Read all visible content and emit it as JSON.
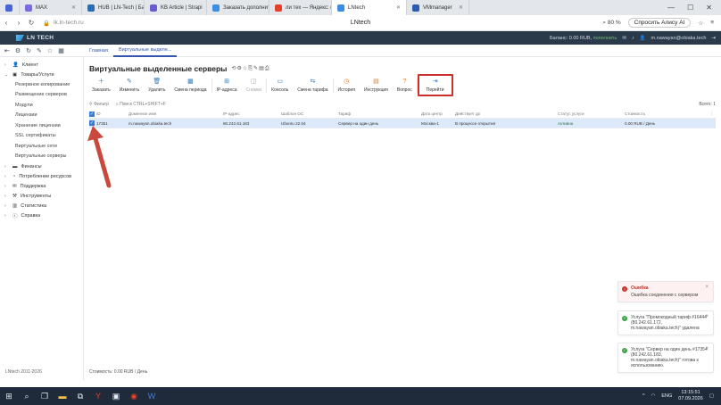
{
  "browser": {
    "tabs": [
      {
        "label": "",
        "color": "#4a63d8",
        "active": false
      },
      {
        "label": "MAX",
        "color": "#7b6be0",
        "active": false
      },
      {
        "label": "HUB | LN-Tech | База знаний",
        "color": "#2b6cb0",
        "active": false
      },
      {
        "label": "KB Article | Strapi",
        "color": "#6a5acd",
        "active": false
      },
      {
        "label": "Заказать дополнительный",
        "color": "#3a8ee6",
        "active": false
      },
      {
        "label": "ли тех — Яндекс: нашлось",
        "color": "#e6402b",
        "active": false
      },
      {
        "label": "LNtech",
        "color": "#3a8ee6",
        "active": true
      },
      {
        "label": "VMmanager",
        "color": "#2a5db0",
        "active": false
      }
    ],
    "page_title": "LNtech",
    "url": "lk.ln-tech.ru",
    "zoom": "80 %",
    "ai_button": "Спросить Алису AI"
  },
  "app_header": {
    "logo_text": "LN TECH",
    "balance_label": "Баланс:",
    "balance_value": "0.00 RUB,",
    "balance_action": "пополнить",
    "user_email": "m.nawayan@obiaka.tech"
  },
  "breadcrumbs": [
    {
      "label": "Главная",
      "current": false
    },
    {
      "label": "Виртуальные выделе...",
      "current": true
    }
  ],
  "sidebar": {
    "sections": [
      {
        "label": "Клиент",
        "icon": "user-icon",
        "expanded": false
      },
      {
        "label": "Товары/Услуги",
        "icon": "box-icon",
        "expanded": true
      }
    ],
    "subitems": [
      "Резервное копирование",
      "Размещение серверов",
      "Модули",
      "Лицензии",
      "Хранение лицензии",
      "SSL сертификаты",
      "Виртуальные сети",
      "Виртуальные серверы"
    ],
    "bottom_sections": [
      {
        "label": "Финансы",
        "icon": "wallet-icon"
      },
      {
        "label": "Потребление ресурсов",
        "icon": "gauge-icon"
      },
      {
        "label": "Поддержка",
        "icon": "support-icon"
      },
      {
        "label": "Инструменты",
        "icon": "wrench-icon"
      },
      {
        "label": "Статистика",
        "icon": "stats-icon"
      },
      {
        "label": "Справка",
        "icon": "help-icon"
      }
    ],
    "footer": "LNtech 2011-2026"
  },
  "page": {
    "title": "Виртуальные выделенные серверы",
    "toolbar": [
      {
        "label": "Заказать",
        "icon": "plus-icon",
        "color": "#2b7bc0",
        "disabled": false,
        "highlight": false
      },
      {
        "label": "Изменить",
        "icon": "edit-icon",
        "color": "#2b7bc0",
        "disabled": false,
        "highlight": false
      },
      {
        "label": "Удалить",
        "icon": "trash-icon",
        "color": "#2b7bc0",
        "disabled": false,
        "highlight": false
      },
      {
        "label": "Смена периода",
        "icon": "calendar-icon",
        "color": "#2b7bc0",
        "disabled": false,
        "highlight": false
      },
      {
        "label": "IP-адреса",
        "icon": "network-icon",
        "color": "#2b7bc0",
        "disabled": false,
        "highlight": false
      },
      {
        "label": "Снимки",
        "icon": "camera-icon",
        "color": "#aaaaaa",
        "disabled": true,
        "highlight": false
      },
      {
        "label": "Консоль",
        "icon": "console-icon",
        "color": "#2b7bc0",
        "disabled": false,
        "highlight": false
      },
      {
        "label": "Смена тарифа",
        "icon": "tariff-icon",
        "color": "#2b7bc0",
        "disabled": false,
        "highlight": false
      },
      {
        "label": "История",
        "icon": "history-icon",
        "color": "#e07a2b",
        "disabled": false,
        "highlight": false
      },
      {
        "label": "Инструкция",
        "icon": "doc-icon",
        "color": "#e07a2b",
        "disabled": false,
        "highlight": false
      },
      {
        "label": "Вопрос",
        "icon": "question-icon",
        "color": "#e07a2b",
        "disabled": false,
        "highlight": false
      },
      {
        "label": "Перейти",
        "icon": "goto-icon",
        "color": "#2b7bc0",
        "disabled": false,
        "highlight": true
      }
    ],
    "filter_label": "Фильтр",
    "search_placeholder": "Поиск CTRL+SHIFT+F",
    "total": "Всего: 1",
    "columns": [
      "ID",
      "Доменное имя",
      "IP-адрес",
      "Шаблон ОС",
      "Тариф",
      "Дата центр",
      "Действует до",
      "Статус услуги",
      "Стоимость"
    ],
    "rows": [
      [
        "17351",
        "m.nawayan.obiaka.tech",
        "80.242.61.183",
        "Ubuntu 22.04",
        "Сервер на один день",
        "Москва-1",
        "В процессе открытия",
        "Активна",
        "0.00 RUB / День"
      ]
    ],
    "cost_footer": "Стоимость: 0.00 RUB / День"
  },
  "notifications": [
    {
      "type": "error",
      "title": "Ошибка",
      "text": "Ошибка соединения с сервером",
      "color": "#c9302c"
    },
    {
      "type": "success",
      "title": "",
      "text": "Услуга \"Промокодный тариф #16444 (80.242.61.172, m.nawayan.obiaka.tech)\" удалена",
      "color": "#3aa547"
    },
    {
      "type": "success",
      "title": "",
      "text": "Услуга \"Сервер на один день #17354 (80.242.61.183, m.nawayan.obiaka.tech)\" готова к использованию.",
      "color": "#3aa547"
    }
  ],
  "taskbar": {
    "lang": "ENG",
    "time": "13:15:51",
    "date": "07.09.2026"
  },
  "colors": {
    "accent": "#2b7bc0",
    "header": "#2b3a4a",
    "highlight_box": "#c9302c",
    "row_selected": "#dbe9fb"
  }
}
